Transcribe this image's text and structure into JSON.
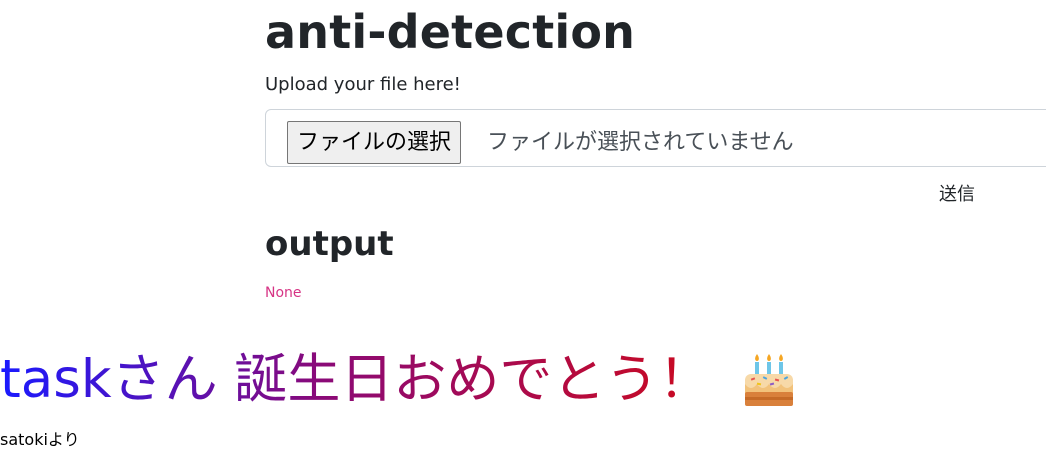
{
  "header": {
    "title": "anti-detection"
  },
  "upload": {
    "label": "Upload your file here!",
    "file_button_label": "ファイルの選択",
    "file_status": "ファイルが選択されていません",
    "submit_label": "送信"
  },
  "output": {
    "heading": "output",
    "value": "None"
  },
  "message": {
    "greeting": "taskさん 誕生日おめでとう！",
    "emoji_icon": "birthday-cake-icon",
    "signature": "satokiより"
  },
  "colors": {
    "output_value": "#d63384",
    "greeting_gradient_start": "#1a1aff",
    "greeting_gradient_mid": "#8a0a78",
    "greeting_gradient_end": "#cc0a1e"
  }
}
